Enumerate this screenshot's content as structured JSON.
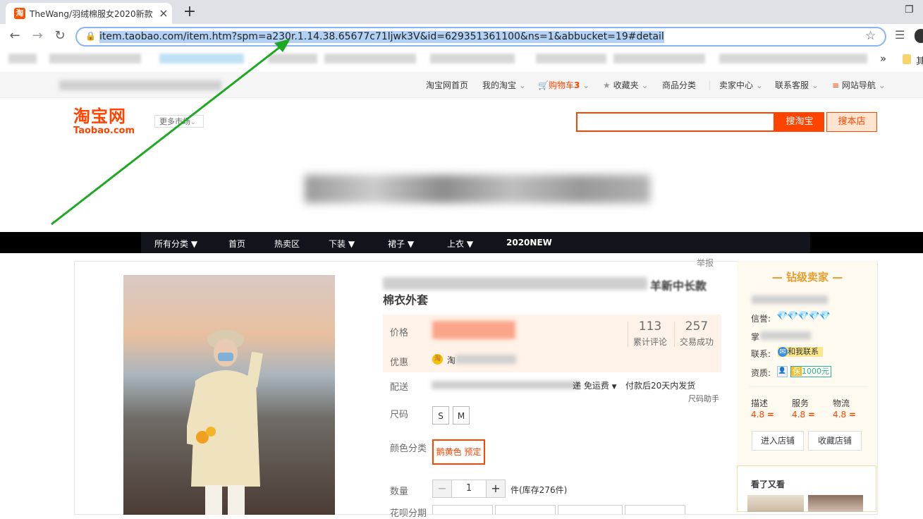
{
  "browser": {
    "tab_title": "TheWang/羽绒棉服女2020新款",
    "url": "item.taobao.com/item.htm?spm=a230r.1.14.38.65677c71ljwk3V&id=629351361100&ns=1&abbucket=19#detail",
    "more_bookmarks": "»",
    "other_bookmarks": "其"
  },
  "sitenav": {
    "home": "淘宝网首页",
    "mytaobao": "我的淘宝",
    "cart": "购物车",
    "cart_count": "3",
    "favorites": "收藏夹",
    "categories": "商品分类",
    "seller_center": "卖家中心",
    "service": "联系客服",
    "site_nav": "网站导航"
  },
  "header": {
    "logo_cn": "淘宝网",
    "logo_en": "Taobao.com",
    "more_market": "更多市场",
    "search_taobao": "搜淘宝",
    "search_store": "搜本店"
  },
  "shopnav": {
    "items": [
      "所有分类",
      "首页",
      "热卖区",
      "下装",
      "裙子",
      "上衣",
      "2020NEW"
    ]
  },
  "product": {
    "report": "举报",
    "title_tail": "羊新中长款",
    "title_line2": "棉衣外套",
    "price_label": "价格",
    "reviews_count": "113",
    "reviews_label": "累计评论",
    "sales_count": "257",
    "sales_label": "交易成功",
    "promo_label": "优惠",
    "promo_text": "淘",
    "delivery_label": "配送",
    "delivery_fee": "递 免运费",
    "shipping_time": "付款后20天内发货",
    "size_helper": "尺码助手",
    "size_label": "尺码",
    "sizes": [
      "S",
      "M"
    ],
    "color_label": "颜色分类",
    "color_option": "鹅黄色 预定",
    "qty_label": "数量",
    "qty_value": "1",
    "stock": "件(库存276件)",
    "next_label": "花呗分期"
  },
  "seller": {
    "level": "钻级卖家",
    "credit_label": "信誉:",
    "owner_label": "掌",
    "contact_label": "联系:",
    "contact_btn": "和我联系",
    "qualification_label": "资质:",
    "deposit": "1000元",
    "ratings": [
      {
        "label": "描述",
        "value": "4.8"
      },
      {
        "label": "服务",
        "value": "4.8"
      },
      {
        "label": "物流",
        "value": "4.8"
      }
    ],
    "enter_store": "进入店铺",
    "favorite_store": "收藏店铺",
    "also_viewed": "看了又看"
  },
  "colors": {
    "accent": "#ff4400",
    "arrow": "#1fa823",
    "diamond": "#2f8be6"
  }
}
